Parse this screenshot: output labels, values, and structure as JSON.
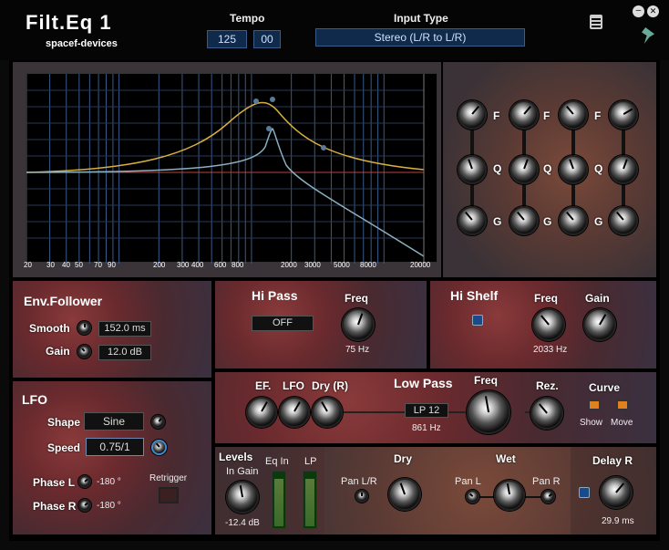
{
  "header": {
    "title": "Filt.Eq  1",
    "vendor": "spacef-devices",
    "tempo_label": "Tempo",
    "tempo_int": "125",
    "tempo_frac": "00",
    "input_type_label": "Input Type",
    "input_type_value": "Stereo (L/R to L/R)"
  },
  "graph": {
    "freq_labels": [
      "20",
      "30",
      "40",
      "50",
      "70",
      "90",
      "200",
      "300",
      "400",
      "600",
      "800",
      "2000",
      "3000",
      "5000",
      "8000",
      "20000"
    ]
  },
  "eq_bands": {
    "f_label": "F",
    "q_label": "Q",
    "g_label": "G"
  },
  "env_follower": {
    "title": "Env.Follower",
    "smooth_label": "Smooth",
    "smooth_value": "152.0 ms",
    "gain_label": "Gain",
    "gain_value": "12.0 dB"
  },
  "hi_pass": {
    "title": "Hi Pass",
    "state": "OFF",
    "freq_label": "Freq",
    "freq_value": "75 Hz"
  },
  "hi_shelf": {
    "title": "Hi Shelf",
    "freq_label": "Freq",
    "freq_value": "2033 Hz",
    "gain_label": "Gain"
  },
  "lfo": {
    "title": "LFO",
    "shape_label": "Shape",
    "shape_value": "Sine",
    "speed_label": "Speed",
    "speed_value": "0.75/1",
    "phase_l_label": "Phase L",
    "phase_l_value": "-180 °",
    "phase_r_label": "Phase R",
    "phase_r_value": "-180 °",
    "retrigger_label": "Retrigger"
  },
  "low_pass": {
    "ef_label": "EF.",
    "lfo_label": "LFO",
    "dry_label": "Dry (R)",
    "title": "Low Pass",
    "type_value": "LP 12",
    "freq_label": "Freq",
    "freq_value": "861 Hz",
    "rez_label": "Rez.",
    "curve_label": "Curve",
    "show_label": "Show",
    "move_label": "Move"
  },
  "levels": {
    "title": "Levels",
    "in_gain_label": "In Gain",
    "in_gain_value": "-12.4 dB",
    "eq_in_label": "Eq In",
    "lp_label": "LP",
    "dry_label": "Dry",
    "pan_lr_label": "Pan L/R",
    "wet_label": "Wet",
    "pan_l_label": "Pan L",
    "pan_r_label": "Pan R",
    "delay_label": "Delay R",
    "delay_value": "29.9 ms"
  }
}
